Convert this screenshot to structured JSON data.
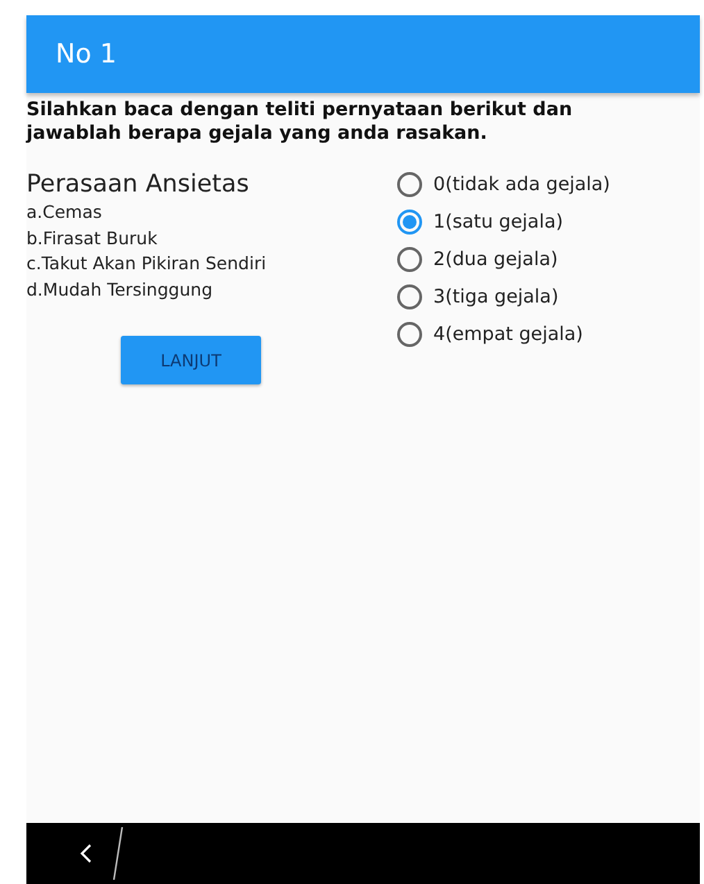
{
  "app_bar": {
    "title": "No 1"
  },
  "instruction": "Silahkan baca dengan teliti pernyataan berikut dan jawablah berapa gejala yang anda rasakan.",
  "question": {
    "title": "Perasaan Ansietas",
    "items": [
      "a.Cemas",
      "b.Firasat Buruk",
      "c.Takut Akan Pikiran Sendiri",
      "d.Mudah Tersinggung"
    ]
  },
  "options": [
    {
      "label": "0(tidak ada gejala)",
      "selected": false
    },
    {
      "label": "1(satu gejala)",
      "selected": true
    },
    {
      "label": "2(dua gejala)",
      "selected": false
    },
    {
      "label": "3(tiga gejala)",
      "selected": false
    },
    {
      "label": "4(empat gejala)",
      "selected": false
    }
  ],
  "button": "LANJUT"
}
